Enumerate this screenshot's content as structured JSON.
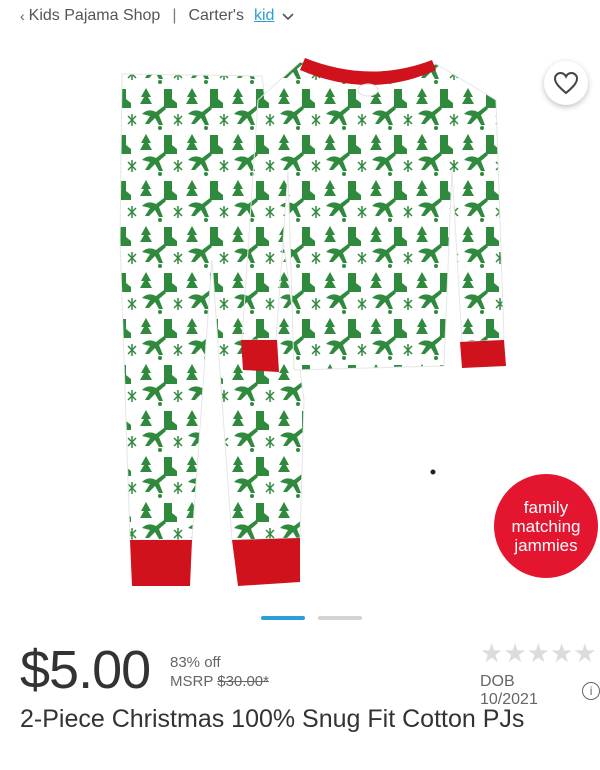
{
  "breadcrumb": {
    "back_label": "Kids Pajama Shop",
    "brand": "Carter's",
    "size_link": "kid"
  },
  "product": {
    "badge_lines": [
      "family",
      "matching",
      "jammies"
    ],
    "price": "$5.00",
    "discount": "83% off",
    "msrp_label": "MSRP",
    "msrp_value": "$30.00*",
    "rating_stars": 5,
    "rating_filled": 0,
    "dob": "DOB 10/2021",
    "title": "2-Piece Christmas 100% Snug Fit Cotton PJs"
  },
  "carousel": {
    "slides": 2,
    "active_index": 0
  },
  "colors": {
    "accent": "#2a9fd6",
    "badge_red": "#e4152f",
    "pajama_green": "#2f8a3e",
    "cuff_red": "#d0121d"
  },
  "icons": {
    "favorite": "heart-icon",
    "back": "chevron-left-icon",
    "dropdown": "chevron-down-icon",
    "info": "info-icon"
  }
}
